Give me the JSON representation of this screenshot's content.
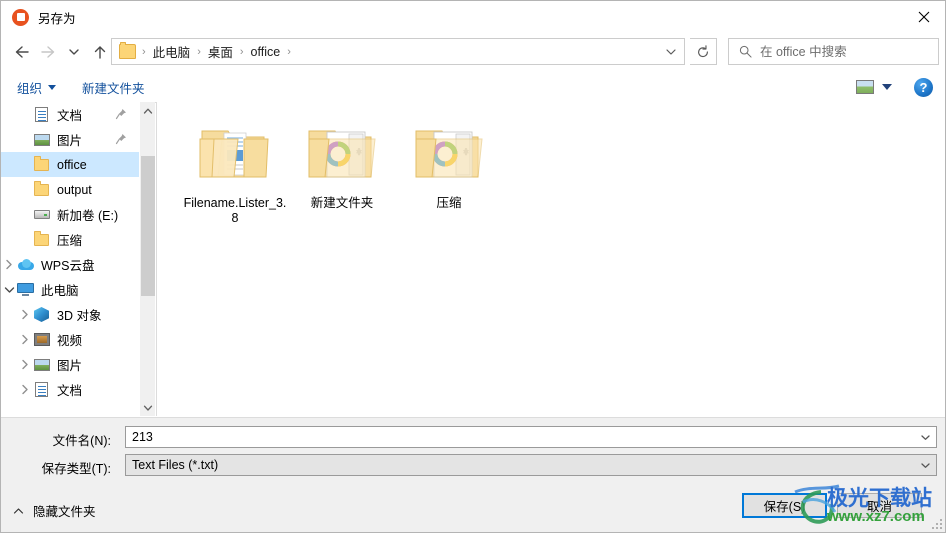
{
  "window": {
    "title": "另存为",
    "app_icon": "powerpoint-icon",
    "close_label": "✕"
  },
  "navigation": {
    "back_icon": "arrow-left-icon",
    "forward_icon": "arrow-right-icon",
    "recent_icon": "chevron-down-icon",
    "up_icon": "arrow-up-icon",
    "breadcrumb": [
      "此电脑",
      "桌面",
      "office"
    ],
    "breadcrumb_separator": "›",
    "address_dropdown_icon": "chevron-down-icon",
    "refresh_icon": "refresh-icon"
  },
  "search": {
    "placeholder": "在 office 中搜索",
    "icon": "search-icon"
  },
  "toolbar": {
    "organize_label": "组织",
    "new_folder_label": "新建文件夹",
    "view_icon": "view-options-icon",
    "view_dropdown_icon": "chevron-down-icon",
    "help_label": "?"
  },
  "sidebar": {
    "items": [
      {
        "label": "文档",
        "icon": "document-icon",
        "indent": 1,
        "chevron": "",
        "pinned": true,
        "selected": false
      },
      {
        "label": "图片",
        "icon": "picture-icon",
        "indent": 1,
        "chevron": "",
        "pinned": true,
        "selected": false
      },
      {
        "label": "office",
        "icon": "folder-icon",
        "indent": 1,
        "chevron": "",
        "pinned": false,
        "selected": true
      },
      {
        "label": "output",
        "icon": "folder-icon",
        "indent": 1,
        "chevron": "",
        "pinned": false,
        "selected": false
      },
      {
        "label": "新加卷 (E:)",
        "icon": "drive-icon",
        "indent": 1,
        "chevron": "",
        "pinned": false,
        "selected": false
      },
      {
        "label": "压缩",
        "icon": "folder-icon",
        "indent": 1,
        "chevron": "",
        "pinned": false,
        "selected": false
      },
      {
        "label": "WPS云盘",
        "icon": "cloud-icon",
        "indent": 0,
        "chevron": "collapsed",
        "pinned": false,
        "selected": false
      },
      {
        "label": "此电脑",
        "icon": "this-pc-icon",
        "indent": 0,
        "chevron": "expanded",
        "pinned": false,
        "selected": false
      },
      {
        "label": "3D 对象",
        "icon": "3d-object-icon",
        "indent": 1,
        "chevron": "collapsed",
        "pinned": false,
        "selected": false
      },
      {
        "label": "视频",
        "icon": "video-icon",
        "indent": 1,
        "chevron": "collapsed",
        "pinned": false,
        "selected": false
      },
      {
        "label": "图片",
        "icon": "picture-icon",
        "indent": 1,
        "chevron": "collapsed",
        "pinned": false,
        "selected": false
      },
      {
        "label": "文档",
        "icon": "document-icon",
        "indent": 1,
        "chevron": "collapsed",
        "pinned": false,
        "selected": false
      }
    ],
    "scroll_up_icon": "chevron-up-icon",
    "scroll_down_icon": "chevron-down-icon"
  },
  "files": [
    {
      "name": "Filename.Lister_3.8",
      "icon": "folder-documents-icon"
    },
    {
      "name": "新建文件夹",
      "icon": "folder-media-icon"
    },
    {
      "name": "压缩",
      "icon": "folder-media-icon"
    }
  ],
  "form": {
    "filename_label": "文件名(N):",
    "filename_value": "213",
    "filetype_label": "保存类型(T):",
    "filetype_value": "Text Files (*.txt)",
    "dropdown_icon": "chevron-down-icon"
  },
  "footer": {
    "hide_folders_label": "隐藏文件夹",
    "hide_folders_icon": "chevron-up-icon",
    "save_label": "保存(S)",
    "cancel_label": "取消"
  },
  "watermark": {
    "main": "极光下载站",
    "sub": "www.xz7.com"
  },
  "colors": {
    "selection": "#cce8ff",
    "focus_border": "#0078d7",
    "toolbar_link": "#12509c",
    "folder": "#fcd577",
    "watermark_blue": "#2f6fd0",
    "watermark_green": "#34a13c"
  }
}
